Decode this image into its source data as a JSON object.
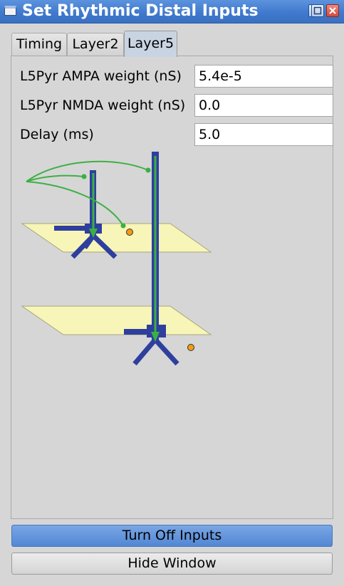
{
  "window": {
    "title": "Set Rhythmic Distal Inputs"
  },
  "tabs": [
    {
      "label": "Timing"
    },
    {
      "label": "Layer2"
    },
    {
      "label": "Layer5"
    }
  ],
  "active_tab": "Layer5",
  "fields": [
    {
      "label": "L5Pyr AMPA weight (nS)",
      "value": "5.4e-5"
    },
    {
      "label": "L5Pyr NMDA weight (nS)",
      "value": "0.0"
    },
    {
      "label": "Delay (ms)",
      "value": "5.0"
    }
  ],
  "buttons": {
    "turn_off": "Turn Off Inputs",
    "hide": "Hide Window"
  },
  "colors": {
    "titlebar": "#3e78cc",
    "input_arrow": "#3cb043",
    "neuron": "#2e3f9e",
    "layer_plane": "#f7f5b8",
    "synapse": "#f39c12"
  },
  "icons": [
    "window-menu-icon",
    "minimize-icon",
    "maximize-icon",
    "close-icon"
  ]
}
